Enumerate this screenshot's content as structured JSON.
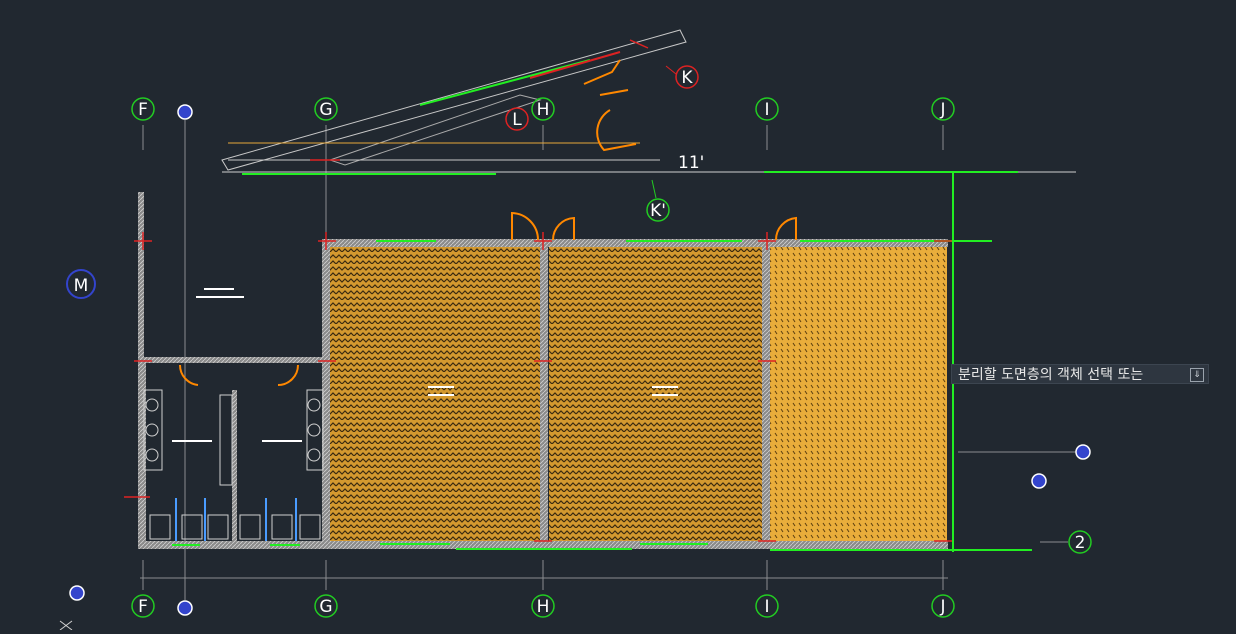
{
  "drawing": {
    "grid_top": [
      "F",
      "G",
      "H",
      "I",
      "J"
    ],
    "grid_bottom": [
      "F",
      "G",
      "H",
      "I",
      "J"
    ],
    "markers": {
      "k": "K",
      "l": "L",
      "k_prime": "K'",
      "m": "M",
      "row_two": "2",
      "dim_11": "11'"
    }
  },
  "tooltip": {
    "prompt": "분리할 도면층의 객체 선택 또는",
    "key_icon": "input-key-icon"
  },
  "colors": {
    "background": "#212830",
    "wall": "#c8c8c8",
    "green": "#22ee22",
    "orange": "#ff8800",
    "hatch": "#e7a83a",
    "red": "#dd2222",
    "blue": "#3344cc"
  }
}
